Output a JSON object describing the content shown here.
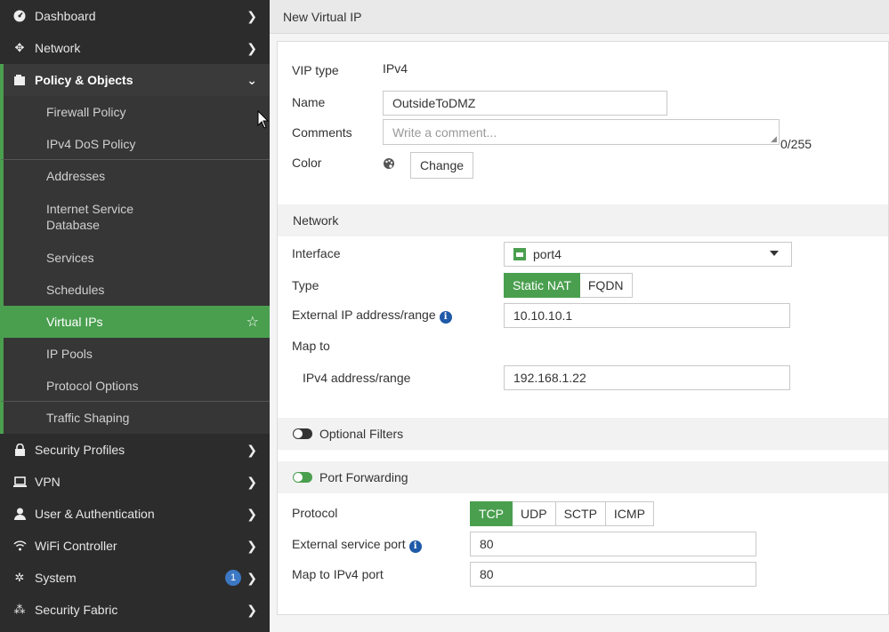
{
  "sidebar": {
    "items": [
      {
        "label": "Dashboard",
        "icon": "dashboard-icon"
      },
      {
        "label": "Network",
        "icon": "network-icon"
      },
      {
        "label": "Policy & Objects",
        "icon": "policy-icon"
      },
      {
        "label": "Security Profiles",
        "icon": "lock-icon"
      },
      {
        "label": "VPN",
        "icon": "laptop-icon"
      },
      {
        "label": "User & Authentication",
        "icon": "user-icon"
      },
      {
        "label": "WiFi Controller",
        "icon": "wifi-icon"
      },
      {
        "label": "System",
        "icon": "gear-icon",
        "badge": "1"
      },
      {
        "label": "Security Fabric",
        "icon": "fabric-icon"
      }
    ],
    "policy_sub": [
      {
        "label": "Firewall Policy"
      },
      {
        "label": "IPv4 DoS Policy"
      },
      {
        "label": "Addresses"
      },
      {
        "label": "Internet Service Database"
      },
      {
        "label": "Services"
      },
      {
        "label": "Schedules"
      },
      {
        "label": "Virtual IPs"
      },
      {
        "label": "IP Pools"
      },
      {
        "label": "Protocol Options"
      },
      {
        "label": "Traffic Shaping"
      }
    ]
  },
  "header": {
    "title": "New Virtual IP"
  },
  "form": {
    "vip_type_label": "VIP type",
    "vip_type_value": "IPv4",
    "name_label": "Name",
    "name_value": "OutsideToDMZ",
    "comments_label": "Comments",
    "comments_placeholder": "Write a comment...",
    "comments_counter": "0/255",
    "color_label": "Color",
    "color_button": "Change"
  },
  "network": {
    "section_title": "Network",
    "interface_label": "Interface",
    "interface_value": "port4",
    "type_label": "Type",
    "type_options": [
      "Static NAT",
      "FQDN"
    ],
    "external_ip_label": "External IP address/range",
    "external_ip_value": "10.10.10.1",
    "map_to_label": "Map to",
    "ipv4_range_label": "IPv4 address/range",
    "ipv4_range_value": "192.168.1.22"
  },
  "optional_filters": {
    "title": "Optional Filters",
    "enabled": false
  },
  "port_forwarding": {
    "title": "Port Forwarding",
    "enabled": true,
    "protocol_label": "Protocol",
    "protocol_options": [
      "TCP",
      "UDP",
      "SCTP",
      "ICMP"
    ],
    "external_port_label": "External service port",
    "external_port_value": "80",
    "map_port_label": "Map to IPv4 port",
    "map_port_value": "80"
  },
  "colors": {
    "accent": "#4a9f4f",
    "sidebar_bg": "#2c2c2c",
    "info_blue": "#1f5aa8"
  }
}
